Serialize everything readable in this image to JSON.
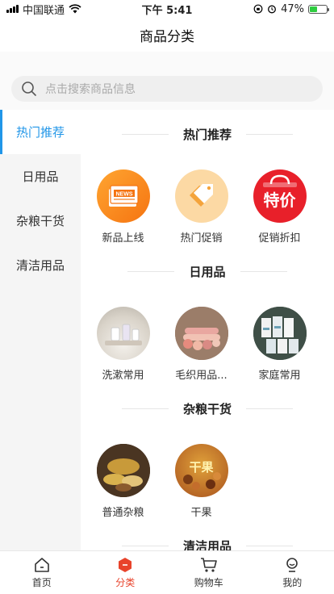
{
  "status_bar": {
    "carrier": "中国联通",
    "time": "下午 5:41",
    "battery_text": "47%",
    "battery_level": 0.47
  },
  "nav": {
    "title": "商品分类"
  },
  "search": {
    "placeholder": "点击搜索商品信息"
  },
  "sidebar": {
    "items": [
      {
        "label": "热门推荐",
        "active": true
      },
      {
        "label": "日用品",
        "active": false
      },
      {
        "label": "杂粮干货",
        "active": false
      },
      {
        "label": "清洁用品",
        "active": false
      }
    ]
  },
  "sections": [
    {
      "title": "热门推荐",
      "items": [
        {
          "label": "新品上线",
          "icon": "news-icon"
        },
        {
          "label": "热门促销",
          "icon": "tag-icon"
        },
        {
          "label": "促销折扣",
          "icon": "sale-bag-icon",
          "badge_text": "特价"
        }
      ]
    },
    {
      "title": "日用品",
      "items": [
        {
          "label": "洗漱常用",
          "icon": "toiletries-photo"
        },
        {
          "label": "毛织用品...",
          "icon": "towels-photo"
        },
        {
          "label": "家庭常用",
          "icon": "cups-photo"
        }
      ]
    },
    {
      "title": "杂粮干货",
      "items": [
        {
          "label": "普通杂粮",
          "icon": "grains-photo"
        },
        {
          "label": "干果",
          "icon": "dried-fruit-photo",
          "badge_text": "干果"
        }
      ]
    },
    {
      "title": "清洁用品",
      "items": []
    }
  ],
  "tab_bar": {
    "items": [
      {
        "label": "首页",
        "icon": "home-icon",
        "active": false
      },
      {
        "label": "分类",
        "icon": "category-icon",
        "active": true
      },
      {
        "label": "购物车",
        "icon": "cart-icon",
        "active": false
      },
      {
        "label": "我的",
        "icon": "profile-icon",
        "active": false
      }
    ]
  },
  "colors": {
    "accent_blue": "#2196e8",
    "accent_red": "#e8432b"
  }
}
